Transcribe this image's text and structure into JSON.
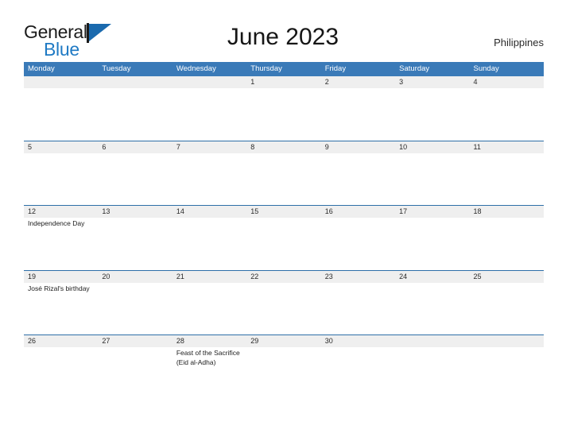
{
  "brand": {
    "name_part1": "General",
    "name_part2": "Blue",
    "flag_icon": "flag-icon"
  },
  "header": {
    "title": "June 2023",
    "country": "Philippines"
  },
  "calendar": {
    "weekdays": [
      "Monday",
      "Tuesday",
      "Wednesday",
      "Thursday",
      "Friday",
      "Saturday",
      "Sunday"
    ],
    "accent_color": "#3a7ab8",
    "strip_color": "#efefef",
    "separator_color": "#2e6fa8",
    "weeks": [
      {
        "days": [
          {
            "num": "",
            "event": ""
          },
          {
            "num": "",
            "event": ""
          },
          {
            "num": "",
            "event": ""
          },
          {
            "num": "1",
            "event": ""
          },
          {
            "num": "2",
            "event": ""
          },
          {
            "num": "3",
            "event": ""
          },
          {
            "num": "4",
            "event": ""
          }
        ]
      },
      {
        "days": [
          {
            "num": "5",
            "event": ""
          },
          {
            "num": "6",
            "event": ""
          },
          {
            "num": "7",
            "event": ""
          },
          {
            "num": "8",
            "event": ""
          },
          {
            "num": "9",
            "event": ""
          },
          {
            "num": "10",
            "event": ""
          },
          {
            "num": "11",
            "event": ""
          }
        ]
      },
      {
        "days": [
          {
            "num": "12",
            "event": "Independence Day"
          },
          {
            "num": "13",
            "event": ""
          },
          {
            "num": "14",
            "event": ""
          },
          {
            "num": "15",
            "event": ""
          },
          {
            "num": "16",
            "event": ""
          },
          {
            "num": "17",
            "event": ""
          },
          {
            "num": "18",
            "event": ""
          }
        ]
      },
      {
        "days": [
          {
            "num": "19",
            "event": "José Rizal's birthday"
          },
          {
            "num": "20",
            "event": ""
          },
          {
            "num": "21",
            "event": ""
          },
          {
            "num": "22",
            "event": ""
          },
          {
            "num": "23",
            "event": ""
          },
          {
            "num": "24",
            "event": ""
          },
          {
            "num": "25",
            "event": ""
          }
        ]
      },
      {
        "days": [
          {
            "num": "26",
            "event": ""
          },
          {
            "num": "27",
            "event": ""
          },
          {
            "num": "28",
            "event": "Feast of the Sacrifice (Eid al-Adha)"
          },
          {
            "num": "29",
            "event": ""
          },
          {
            "num": "30",
            "event": ""
          },
          {
            "num": "",
            "event": ""
          },
          {
            "num": "",
            "event": ""
          }
        ]
      }
    ]
  }
}
